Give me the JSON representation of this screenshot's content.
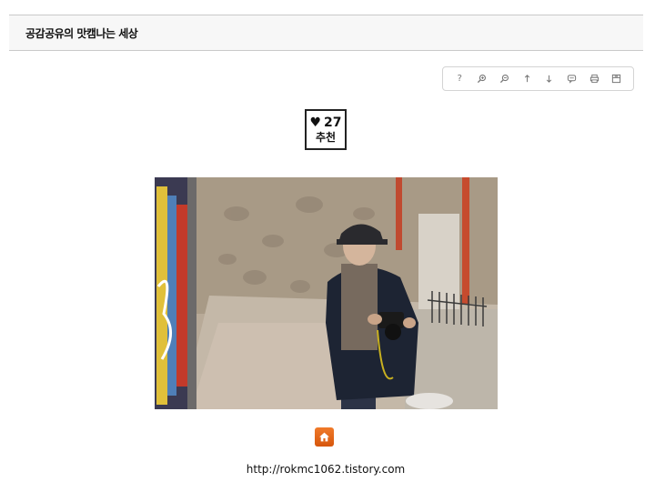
{
  "header": {
    "title": "공감공유의 맛캠나는 세상"
  },
  "toolbar": {
    "buttons": [
      {
        "icon": "help-icon",
        "glyph": "?"
      },
      {
        "icon": "zoom-in-icon"
      },
      {
        "icon": "zoom-out-icon"
      },
      {
        "icon": "arrow-up-icon"
      },
      {
        "icon": "arrow-down-icon"
      },
      {
        "icon": "comment-icon"
      },
      {
        "icon": "print-icon"
      },
      {
        "icon": "save-icon"
      }
    ]
  },
  "recommend": {
    "heart": "♥",
    "count": "27",
    "label": "추천"
  },
  "photo": {
    "subject": "man-with-camera-photo"
  },
  "home": {
    "icon": "home-icon",
    "color": "#e8691c"
  },
  "footer": {
    "url": "http://rokmc1062.tistory.com"
  }
}
